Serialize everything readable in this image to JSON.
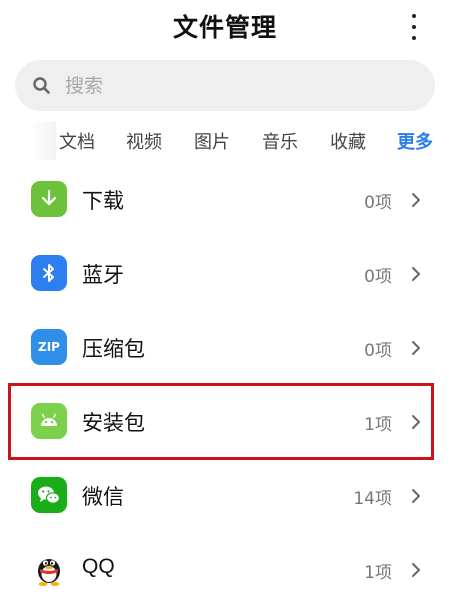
{
  "header": {
    "title": "文件管理",
    "menu_icon": "more-vertical-icon"
  },
  "search": {
    "placeholder": "搜索",
    "value": "",
    "icon": "search-icon"
  },
  "tabs": [
    {
      "label": "文档"
    },
    {
      "label": "视频"
    },
    {
      "label": "图片"
    },
    {
      "label": "音乐"
    },
    {
      "label": "收藏"
    },
    {
      "label": "更多",
      "active": true,
      "color": "#2b7de9"
    }
  ],
  "categories": [
    {
      "label": "下载",
      "count": "0项",
      "icon": "download-icon",
      "color": "#6cc23a"
    },
    {
      "label": "蓝牙",
      "count": "0项",
      "icon": "bluetooth-icon",
      "color": "#2d7ff0"
    },
    {
      "label": "压缩包",
      "count": "0项",
      "icon": "zip-icon",
      "icon_text": "ZIP",
      "color": "#2f8ee8"
    },
    {
      "label": "安装包",
      "count": "1项",
      "icon": "android-icon",
      "color": "#7bd14a",
      "highlighted": true
    },
    {
      "label": "微信",
      "count": "14项",
      "icon": "wechat-icon",
      "color": "#1aad19"
    },
    {
      "label": "QQ",
      "count": "1项",
      "icon": "qq-penguin-icon"
    }
  ],
  "highlight_color": "#c8141b"
}
